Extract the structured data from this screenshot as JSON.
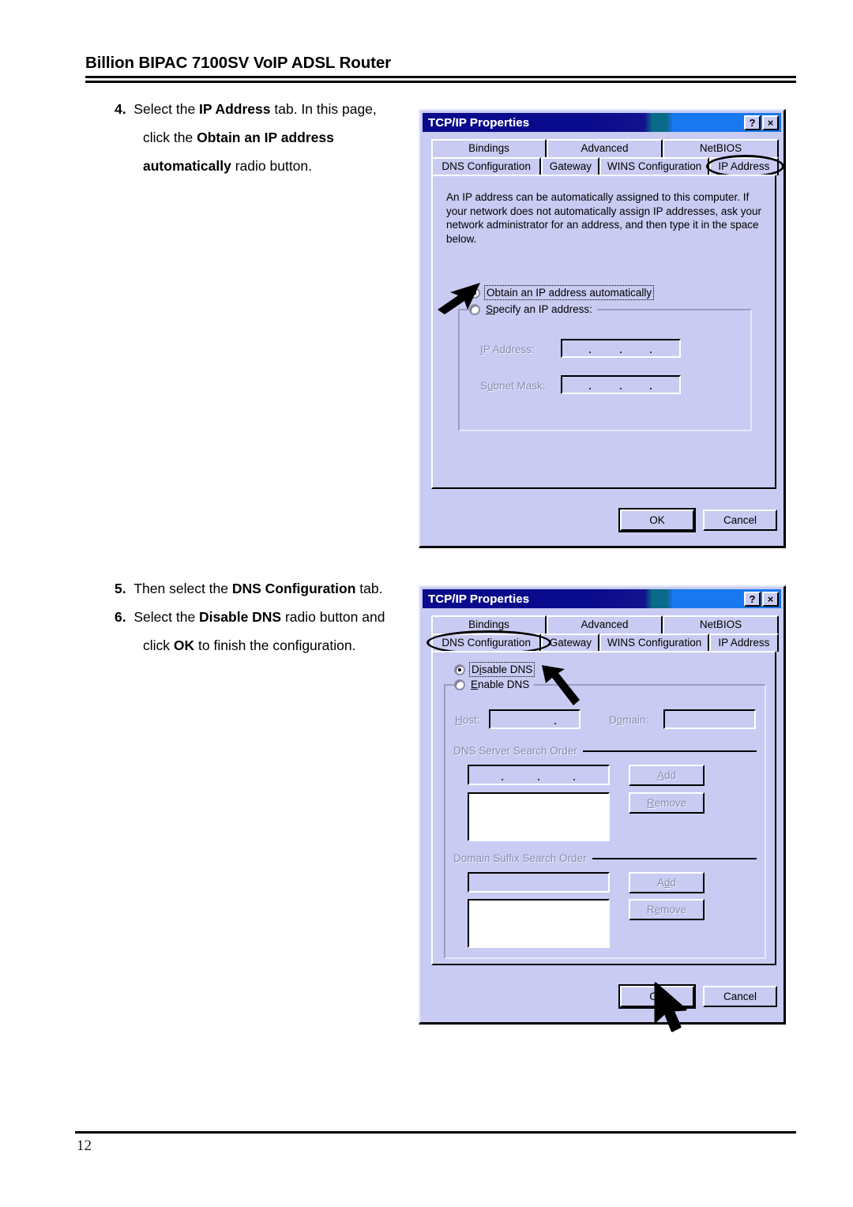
{
  "page": {
    "header_title": "Billion BIPAC 7100SV VoIP ADSL Router",
    "page_number": "12"
  },
  "instructions": [
    {
      "number": "4.",
      "segments": [
        {
          "text": "Select the ",
          "bold": false
        },
        {
          "text": "IP Address",
          "bold": true
        },
        {
          "text": " tab. In this page, click the ",
          "bold": false
        },
        {
          "text": "Obtain an IP address automatically",
          "bold": true
        },
        {
          "text": " radio button.",
          "bold": false
        }
      ]
    },
    {
      "number": "5.",
      "segments": [
        {
          "text": "Then select the ",
          "bold": false
        },
        {
          "text": "DNS Configuration",
          "bold": true
        },
        {
          "text": " tab.",
          "bold": false
        }
      ]
    },
    {
      "number": "6.",
      "segments": [
        {
          "text": "Select the ",
          "bold": false
        },
        {
          "text": "Disable DNS",
          "bold": true
        },
        {
          "text": " radio button and click ",
          "bold": false
        },
        {
          "text": "OK",
          "bold": true
        },
        {
          "text": " to finish the configuration.",
          "bold": false
        }
      ]
    }
  ],
  "dialog_ip": {
    "title": "TCP/IP Properties",
    "help_button": "?",
    "close_button": "×",
    "tabs_row1": [
      "Bindings",
      "Advanced",
      "NetBIOS"
    ],
    "tabs_row2": [
      "DNS Configuration",
      "Gateway",
      "WINS Configuration",
      "IP Address"
    ],
    "active_tab": "IP Address",
    "description": "An IP address can be automatically assigned to this computer. If your network does not automatically assign IP addresses, ask your network administrator for an address, and then type it in the space below.",
    "radio_auto": "Obtain an IP address automatically",
    "radio_auto_selected": true,
    "radio_specify": "Specify an IP address:",
    "radio_specify_selected": false,
    "label_ip_address": "IP Address:",
    "label_subnet_mask": "Subnet Mask:",
    "value_ip_address": "",
    "value_subnet_mask": "",
    "ok_label": "OK",
    "cancel_label": "Cancel"
  },
  "dialog_dns": {
    "title": "TCP/IP Properties",
    "help_button": "?",
    "close_button": "×",
    "tabs_row1": [
      "Bindings",
      "Advanced",
      "NetBIOS"
    ],
    "tabs_row2": [
      "DNS Configuration",
      "Gateway",
      "WINS Configuration",
      "IP Address"
    ],
    "active_tab": "DNS Configuration",
    "radio_disable": "Disable DNS",
    "radio_disable_selected": true,
    "radio_enable": "Enable DNS",
    "radio_enable_selected": false,
    "label_host": "Host:",
    "label_domain": "Domain:",
    "value_host": "",
    "value_domain": "",
    "group_dns_search": "DNS Server Search Order",
    "group_domain_suffix": "Domain Suffix Search Order",
    "add_label_1": "Add",
    "remove_label_1": "Remove",
    "add_label_2": "Add",
    "remove_label_2": "Remove",
    "ok_label": "OK",
    "cancel_label": "Cancel"
  },
  "colors": {
    "dialog_face": "#c9cbf2",
    "titlebar_start": "#0a0a8c",
    "titlebar_mid": "#0b6a8a",
    "titlebar_end": "#1878f0",
    "disabled_text": "#8a8cad",
    "annotation": "#000000"
  }
}
